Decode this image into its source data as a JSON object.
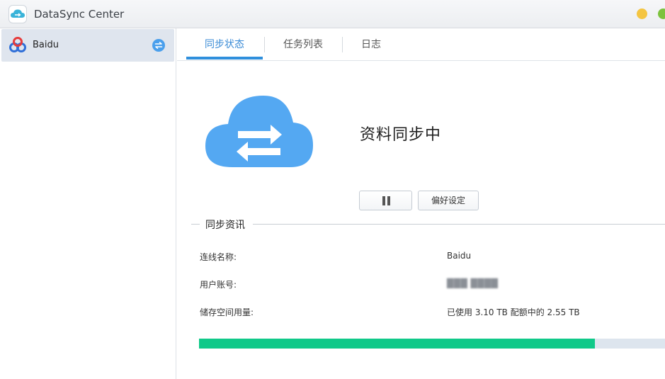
{
  "window": {
    "title": "DataSync Center"
  },
  "sidebar": {
    "items": [
      {
        "label": "Baidu",
        "status": "syncing",
        "icon": "baidu-cloud-icon"
      }
    ]
  },
  "tabs": [
    {
      "label": "同步状态",
      "active": true
    },
    {
      "label": "任务列表",
      "active": false
    },
    {
      "label": "日志",
      "active": false
    }
  ],
  "status": {
    "icon": "cloud-sync-icon",
    "title": "资料同步中",
    "pause_icon": "pause-icon",
    "preferences_label": "偏好设定"
  },
  "sync_info": {
    "section_title": "同步资讯",
    "rows": [
      {
        "label": "连线名称:",
        "value": "Baidu"
      },
      {
        "label": "用户账号:",
        "value": "███ ████"
      },
      {
        "label": "储存空间用量:",
        "value": "已使用 3.10 TB 配额中的 2.55 TB"
      }
    ],
    "usage_progress": 0.85
  },
  "colors": {
    "accent": "#2f8fdc",
    "cloud": "#54a8f2",
    "progress": "#10c989",
    "progress_track": "#dde5ee",
    "sidebar_selected": "#dfe5ee"
  }
}
